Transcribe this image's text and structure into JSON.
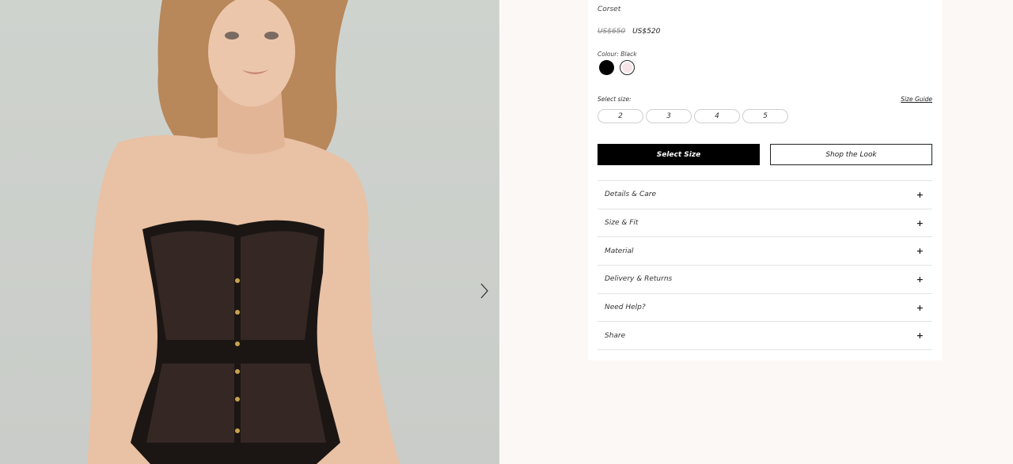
{
  "product": {
    "subtitle": "Corset",
    "price_original": "US$650",
    "price_sale": "US$520"
  },
  "colour": {
    "label": "Colour:",
    "selected": "Black",
    "swatches": [
      {
        "name": "Black",
        "hex": "#000000"
      },
      {
        "name": "Blush",
        "hex": "#f7e4e6"
      }
    ]
  },
  "size": {
    "label": "Select size:",
    "guide_link": "Size Guide",
    "options": [
      "2",
      "3",
      "4",
      "5"
    ]
  },
  "buttons": {
    "select_size": "Select Size",
    "shop_look": "Shop the Look"
  },
  "accordion": [
    {
      "label": "Details & Care",
      "icon": "+"
    },
    {
      "label": "Size & Fit",
      "icon": "+"
    },
    {
      "label": "Material",
      "icon": "+"
    },
    {
      "label": "Delivery & Returns",
      "icon": "+"
    },
    {
      "label": "Need Help?",
      "icon": "+"
    },
    {
      "label": "Share",
      "icon": "+"
    }
  ],
  "gallery": {
    "next_icon": "chevron-right-icon"
  },
  "colors": {
    "page_bg": "#fcf8f5",
    "primary_button": "#000000",
    "border": "#e4e4e4"
  }
}
